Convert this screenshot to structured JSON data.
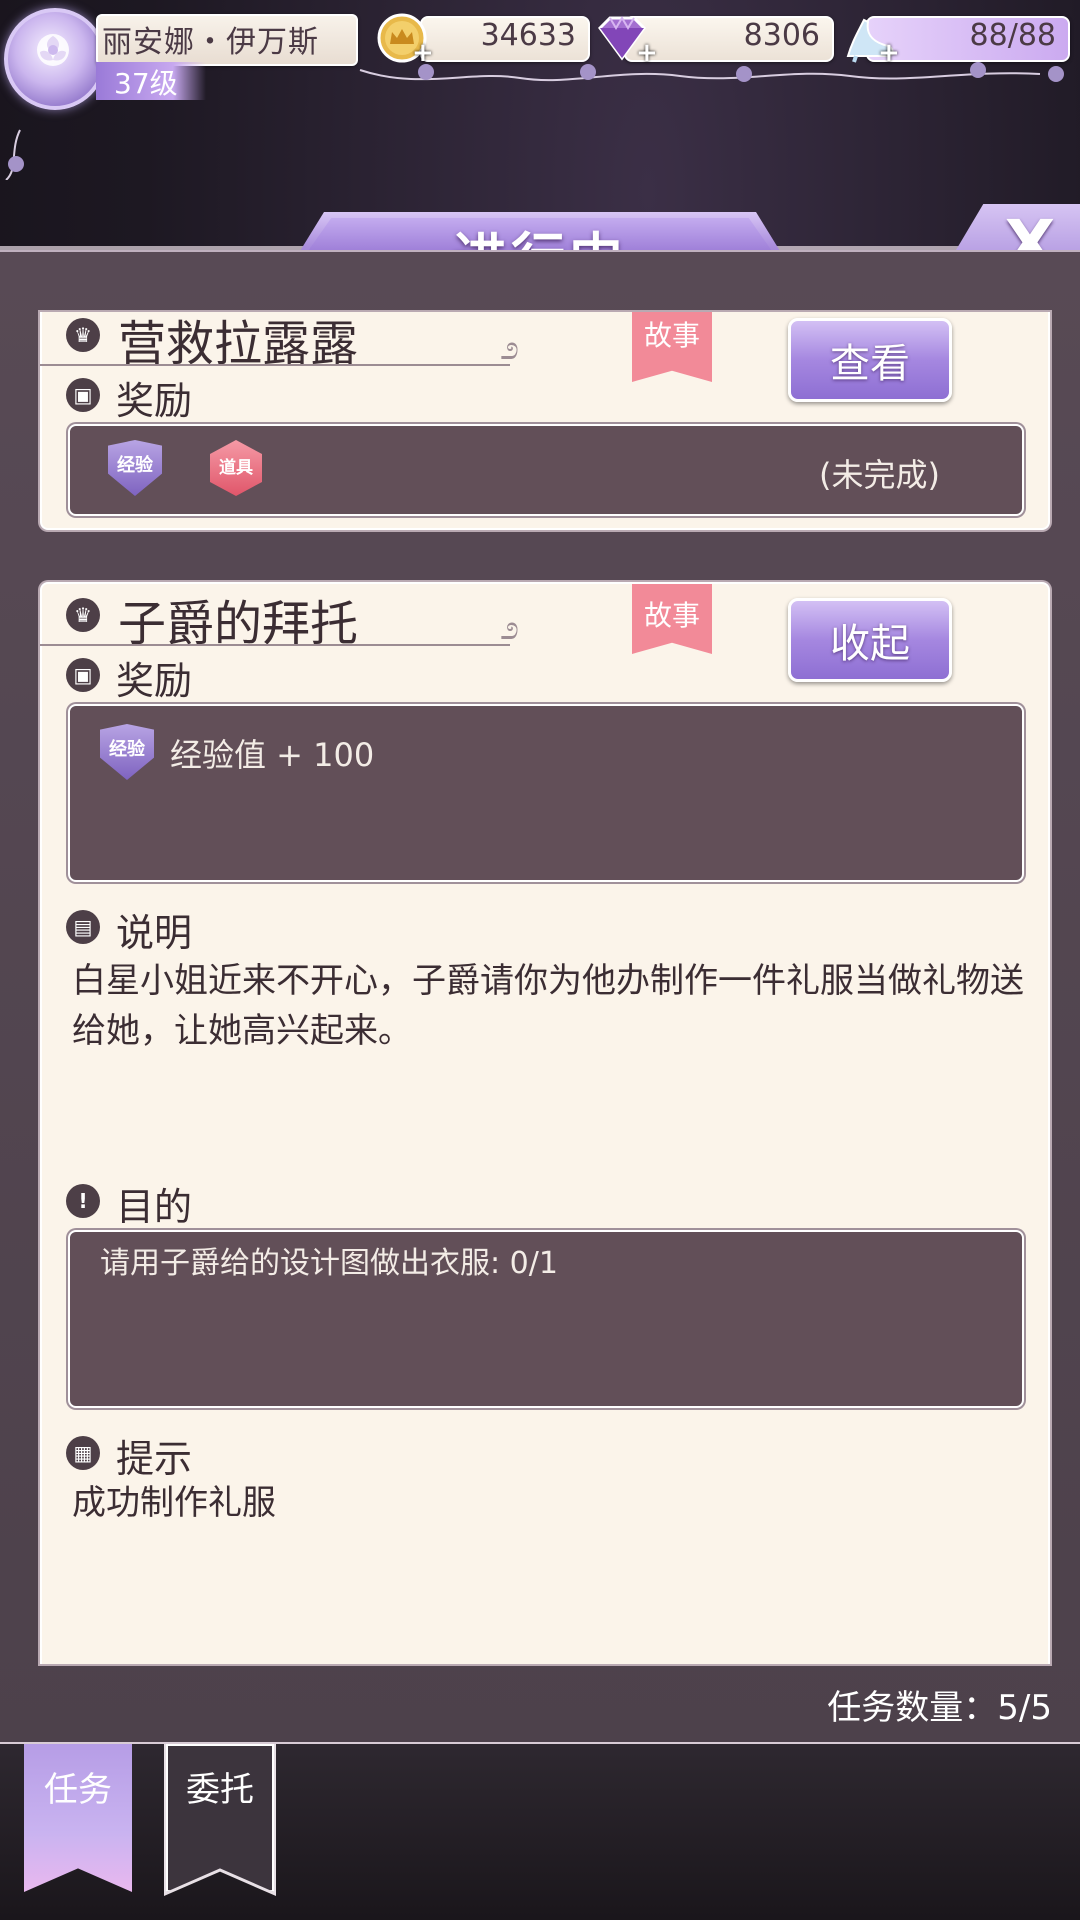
{
  "player": {
    "name": "丽安娜・伊万斯",
    "level": "37级"
  },
  "resources": {
    "gold": "34633",
    "diamond": "8306",
    "stamina": "88/88"
  },
  "header": {
    "title": "进行中",
    "close_label": "X"
  },
  "quests": [
    {
      "title": "营救拉露露",
      "tag": "故事",
      "action_label": "查看",
      "reward_label": "奖励",
      "reward_badges": [
        "经验",
        "道具"
      ],
      "status": "(未完成)"
    },
    {
      "title": "子爵的拜托",
      "tag": "故事",
      "action_label": "收起",
      "reward_label": "奖励",
      "reward_badge": "经验",
      "reward_text": "经验值 + 100",
      "description_label": "说明",
      "description": "白星小姐近来不开心，子爵请你为他办制作一件礼服当做礼物送给她，让她高兴起来。",
      "objective_label": "目的",
      "objective": "请用子爵给的设计图做出衣服: 0/1",
      "hint_label": "提示",
      "hint": "成功制作礼服"
    }
  ],
  "footer": {
    "quest_count": "任务数量：5/5"
  },
  "tabs": {
    "tasks": "任务",
    "delegate": "委托"
  },
  "colors": {
    "accent_purple": "#9b7bd6",
    "ribbon_pink": "#f28a98",
    "panel_bg": "#584a55",
    "card_bg": "#fbf4ea",
    "dark_box": "#624f58"
  }
}
